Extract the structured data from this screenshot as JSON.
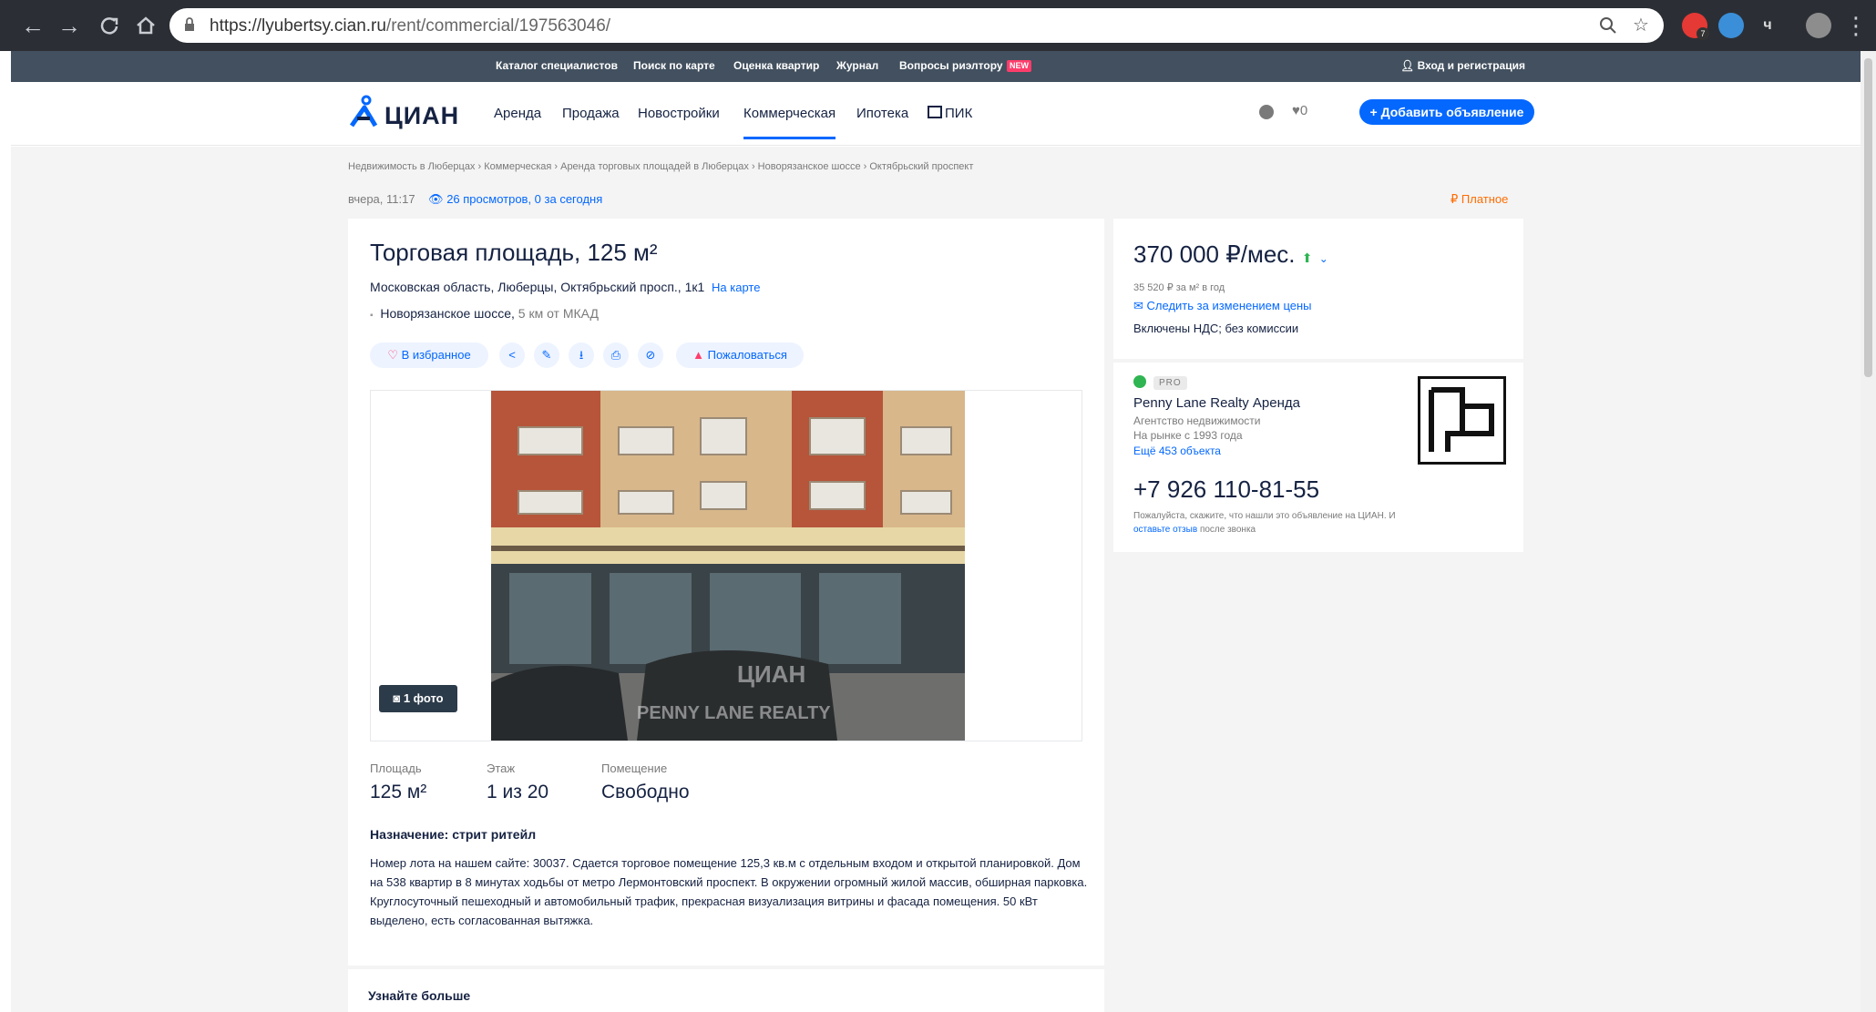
{
  "browser": {
    "url_host": "https://lyubertsy.cian.ru",
    "url_path": "/rent/commercial/197563046/",
    "ext_badge": "7"
  },
  "topbar": {
    "links": [
      "Каталог специалистов",
      "Поиск по карте",
      "Оценка квартир",
      "Журнал",
      "Вопросы риэлтору"
    ],
    "new_badge": "NEW",
    "login": "Вход и регистрация"
  },
  "header": {
    "logo": "ЦИАН",
    "nav": [
      "Аренда",
      "Продажа",
      "Новостройки",
      "Коммерческая",
      "Ипотека",
      "ПИК"
    ],
    "favorites_count": "0",
    "add_button": "+ Добавить объявление"
  },
  "breadcrumbs": "Недвижимость в Люберцах › Коммерческая › Аренда торговых площадей в Люберцах › Новорязанское шоссе › Октябрьский проспект",
  "meta": {
    "date": "вчера, 11:17",
    "views": "26 просмотров, 0 за сегодня",
    "paid": "Платное"
  },
  "listing": {
    "title": "Торговая площадь, 125 м²",
    "address": "Московская область, Люберцы, Октябрьский просп., 1к1",
    "map_link": "На карте",
    "road": "Новорязанское шоссе,",
    "road_distance": "5 км от МКАД",
    "actions": {
      "favorite": "В избранное",
      "report": "Пожаловаться"
    },
    "photo_count": "1 фото",
    "photo_watermarks": [
      "PENNY LANE REALTY",
      "ЦИАН"
    ],
    "stats": [
      {
        "label": "Площадь",
        "value": "125 м²"
      },
      {
        "label": "Этаж",
        "value": "1 из 20"
      },
      {
        "label": "Помещение",
        "value": "Свободно"
      }
    ],
    "purpose": "Назначение: стрит ритейл",
    "description": "Номер лота на нашем сайте: 30037. Сдается торговое помещение 125,3 кв.м с отдельным входом и открытой планировкой. Дом на 538 квартир в 8 минутах ходьбы от метро Лермонтовский проспект. В окружении огромный жилой массив, обширная парковка. Круглосуточный пешеходный и автомобильный трафик, прекрасная визуализация витрины и фасада помещения. 50 кВт выделено, есть согласованная вытяжка.",
    "learn_more": "Узнайте больше"
  },
  "sidebar": {
    "price": "370 000 ₽/мес.",
    "price_per_sqm": "35 520 ₽ за м² в год",
    "follow_price": "Следить за изменением цены",
    "vat": "Включены НДС; без комиссии",
    "pro_badge": "PRO",
    "agency_name": "Penny Lane Realty Аренда",
    "agency_type": "Агентство недвижимости",
    "agency_since": "На рынке с 1993 года",
    "agency_more": "Ещё 453 объекта",
    "phone": "+7 926 110-81-55",
    "note_before": "Пожалуйста, скажите, что нашли это объявление на ЦИАН. И",
    "note_link": "оставьте отзыв",
    "note_after": "после звонка"
  },
  "colors": {
    "brand_blue": "#0468ff",
    "topbar": "#42505f",
    "paid_orange": "#ff6c00"
  }
}
